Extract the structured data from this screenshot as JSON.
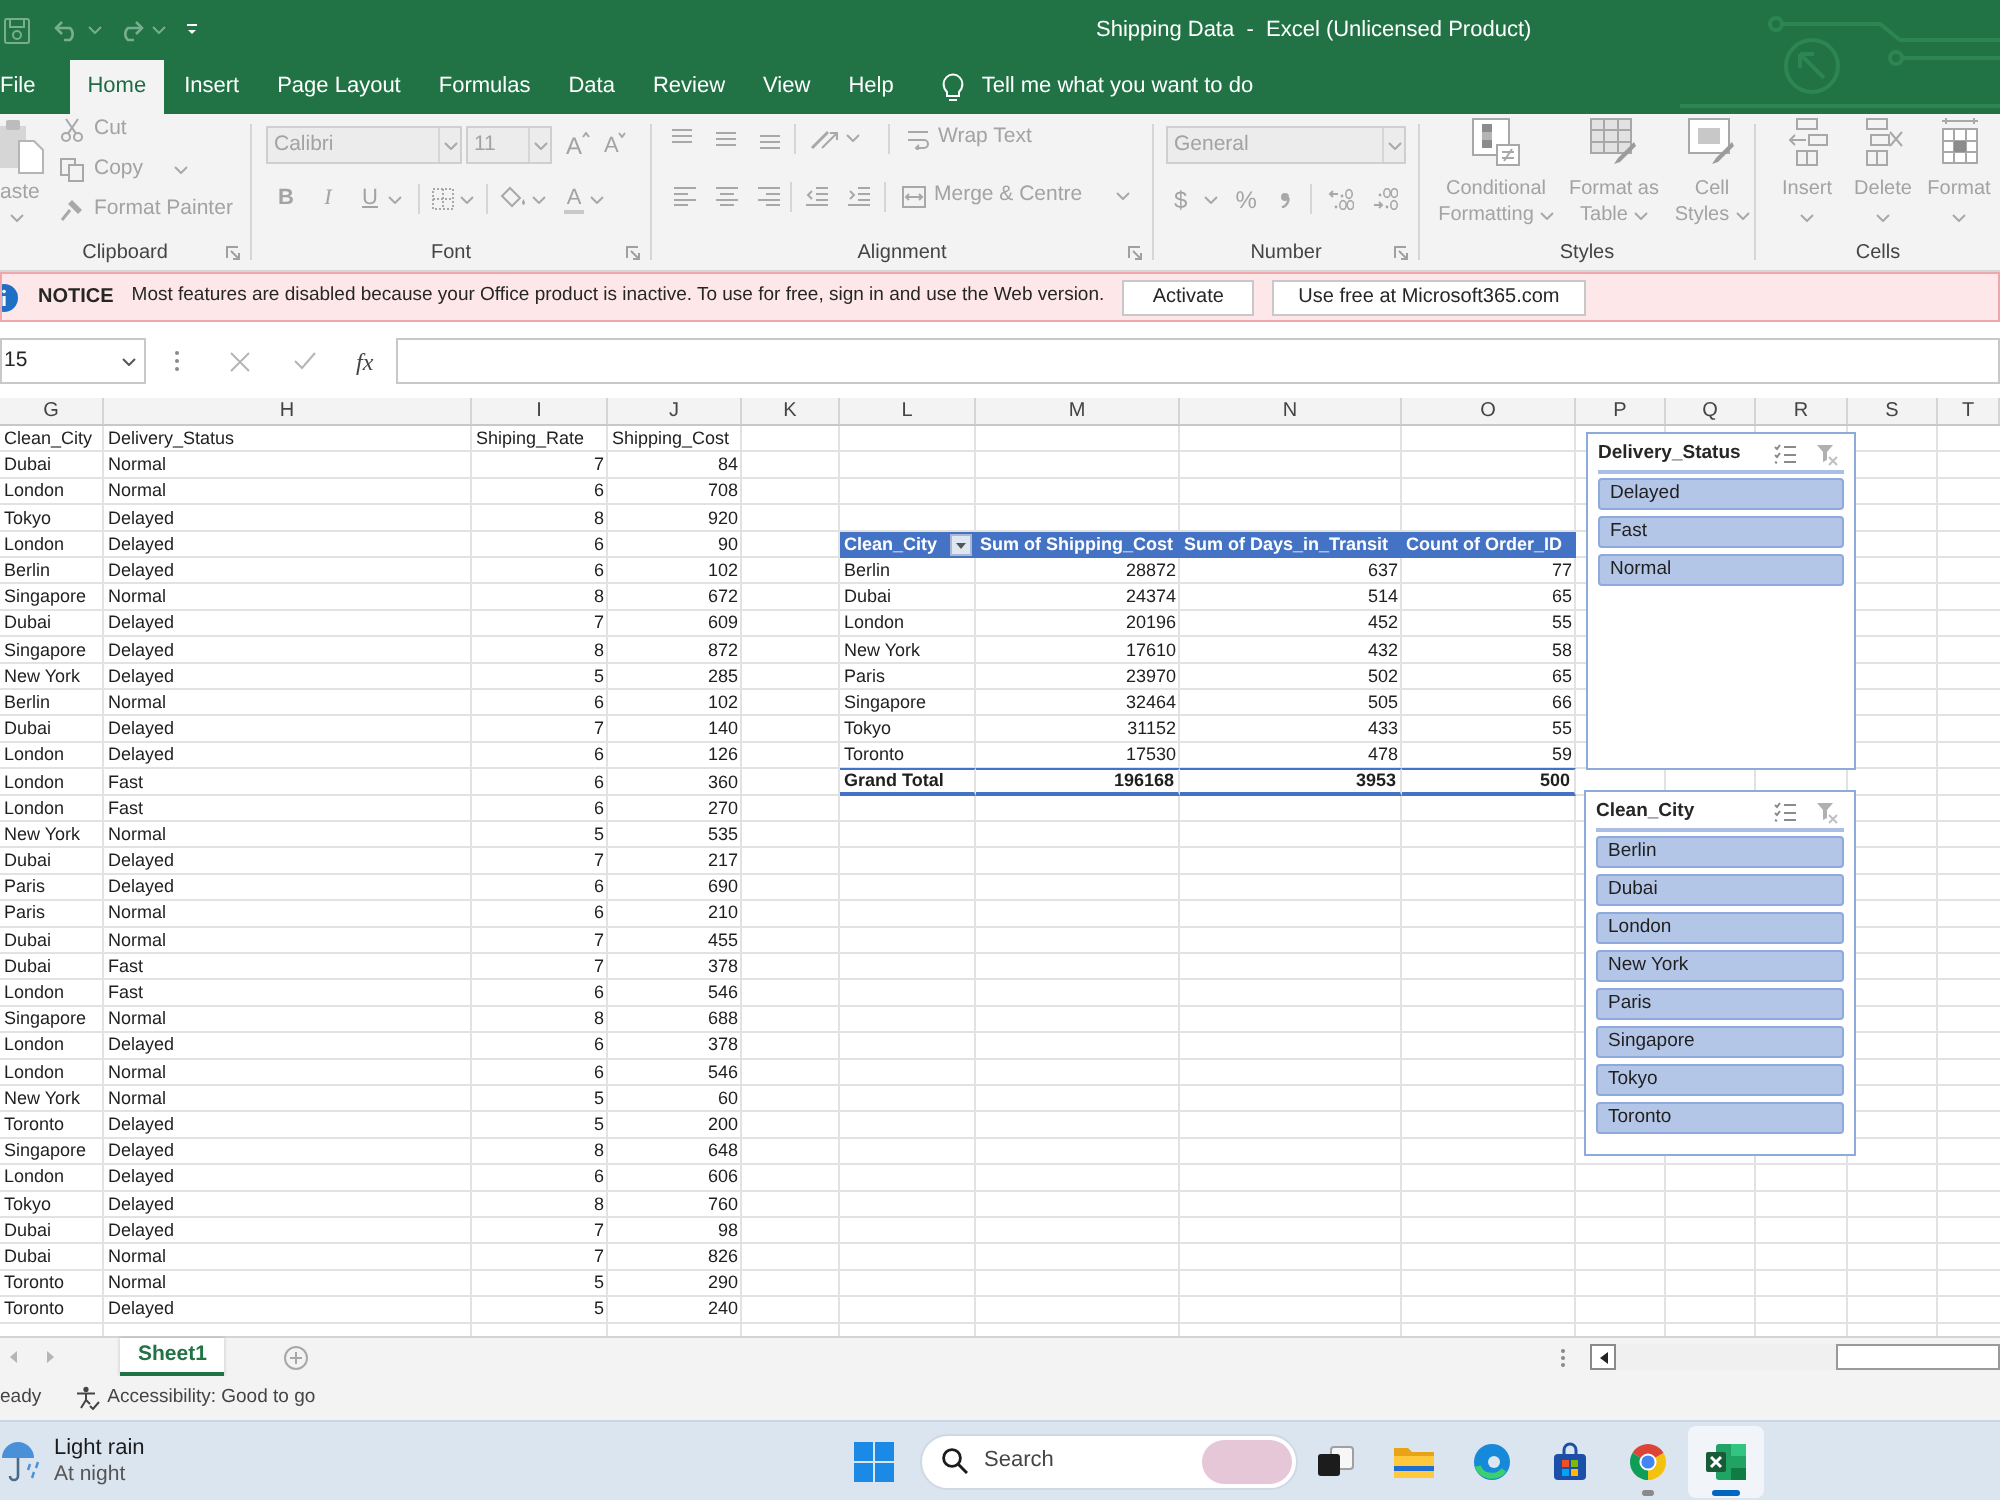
{
  "title_bar": {
    "title": "Shipping Data  -  Excel (Unlicensed Product)"
  },
  "ribbon_tabs": [
    {
      "label": "File",
      "selected": false
    },
    {
      "label": "Home",
      "selected": true
    },
    {
      "label": "Insert",
      "selected": false
    },
    {
      "label": "Page Layout",
      "selected": false
    },
    {
      "label": "Formulas",
      "selected": false
    },
    {
      "label": "Data",
      "selected": false
    },
    {
      "label": "Review",
      "selected": false
    },
    {
      "label": "View",
      "selected": false
    },
    {
      "label": "Help",
      "selected": false
    }
  ],
  "tell_me": "Tell me what you want to do",
  "ribbon": {
    "disabled": true,
    "clipboard": {
      "label": "Clipboard",
      "paste": "aste",
      "cut": "Cut",
      "copy": "Copy",
      "format_painter": "Format Painter"
    },
    "font": {
      "label": "Font",
      "font_name": "Calibri",
      "font_size": "11",
      "grow": "A",
      "shrink": "A",
      "bold": "B",
      "italic": "I",
      "underline": "U",
      "font_color": "A"
    },
    "alignment": {
      "label": "Alignment",
      "wrap_text": "Wrap Text",
      "merge": "Merge & Centre"
    },
    "number": {
      "label": "Number",
      "format": "General",
      "currency": "$",
      "percent": "%"
    },
    "styles": {
      "label": "Styles",
      "buttons": [
        {
          "kind": "conditional",
          "lines": [
            "Conditional",
            "Formatting"
          ]
        },
        {
          "kind": "table",
          "lines": [
            "Format as",
            "Table"
          ]
        },
        {
          "kind": "cell-styles",
          "lines": [
            "Cell",
            "Styles"
          ]
        }
      ]
    },
    "cells": {
      "label": "Cells",
      "buttons": [
        {
          "kind": "insert",
          "label": "Insert"
        },
        {
          "kind": "delete",
          "label": "Delete"
        },
        {
          "kind": "format",
          "label": "Format"
        }
      ]
    }
  },
  "notice": {
    "heading": "NOTICE",
    "message": "Most features are disabled because your Office product is inactive. To use for free, sign in and use the Web version.",
    "buttons": [
      "Activate",
      "Use free at Microsoft365.com"
    ]
  },
  "formula_bar": {
    "name_box": "15",
    "function_label": "fx"
  },
  "sheet": {
    "columns": [
      "G",
      "H",
      "I",
      "J",
      "K",
      "L",
      "M",
      "N",
      "O",
      "P",
      "Q",
      "R",
      "S",
      "T"
    ],
    "header": [
      "Clean_City",
      "Delivery_Status",
      "Shiping_Rate",
      "Shipping_Cost"
    ],
    "rows": [
      [
        "Dubai",
        "Normal",
        "7",
        "84"
      ],
      [
        "London",
        "Normal",
        "6",
        "708"
      ],
      [
        "Tokyo",
        "Delayed",
        "8",
        "920"
      ],
      [
        "London",
        "Delayed",
        "6",
        "90"
      ],
      [
        "Berlin",
        "Delayed",
        "6",
        "102"
      ],
      [
        "Singapore",
        "Normal",
        "8",
        "672"
      ],
      [
        "Dubai",
        "Delayed",
        "7",
        "609"
      ],
      [
        "Singapore",
        "Delayed",
        "8",
        "872"
      ],
      [
        "New York",
        "Delayed",
        "5",
        "285"
      ],
      [
        "Berlin",
        "Normal",
        "6",
        "102"
      ],
      [
        "Dubai",
        "Delayed",
        "7",
        "140"
      ],
      [
        "London",
        "Delayed",
        "6",
        "126"
      ],
      [
        "London",
        "Fast",
        "6",
        "360"
      ],
      [
        "London",
        "Fast",
        "6",
        "270"
      ],
      [
        "New York",
        "Normal",
        "5",
        "535"
      ],
      [
        "Dubai",
        "Delayed",
        "7",
        "217"
      ],
      [
        "Paris",
        "Delayed",
        "6",
        "690"
      ],
      [
        "Paris",
        "Normal",
        "6",
        "210"
      ],
      [
        "Dubai",
        "Normal",
        "7",
        "455"
      ],
      [
        "Dubai",
        "Fast",
        "7",
        "378"
      ],
      [
        "London",
        "Fast",
        "6",
        "546"
      ],
      [
        "Singapore",
        "Normal",
        "8",
        "688"
      ],
      [
        "London",
        "Delayed",
        "6",
        "378"
      ],
      [
        "London",
        "Normal",
        "6",
        "546"
      ],
      [
        "New York",
        "Normal",
        "5",
        "60"
      ],
      [
        "Toronto",
        "Delayed",
        "5",
        "200"
      ],
      [
        "Singapore",
        "Delayed",
        "8",
        "648"
      ],
      [
        "London",
        "Delayed",
        "6",
        "606"
      ],
      [
        "Tokyo",
        "Delayed",
        "8",
        "760"
      ],
      [
        "Dubai",
        "Delayed",
        "7",
        "98"
      ],
      [
        "Dubai",
        "Normal",
        "7",
        "826"
      ],
      [
        "Toronto",
        "Normal",
        "5",
        "290"
      ],
      [
        "Toronto",
        "Delayed",
        "5",
        "240"
      ]
    ]
  },
  "pivot": {
    "columns": [
      "Clean_City",
      "Sum of Shipping_Cost",
      "Sum of Days_in_Transit",
      "Count of Order_ID"
    ],
    "rows": [
      [
        "Berlin",
        "28872",
        "637",
        "77"
      ],
      [
        "Dubai",
        "24374",
        "514",
        "65"
      ],
      [
        "London",
        "20196",
        "452",
        "55"
      ],
      [
        "New York",
        "17610",
        "432",
        "58"
      ],
      [
        "Paris",
        "23970",
        "502",
        "65"
      ],
      [
        "Singapore",
        "32464",
        "505",
        "66"
      ],
      [
        "Tokyo",
        "31152",
        "433",
        "55"
      ],
      [
        "Toronto",
        "17530",
        "478",
        "59"
      ]
    ],
    "total": [
      "Grand Total",
      "196168",
      "3953",
      "500"
    ]
  },
  "slicers": [
    {
      "title": "Delivery_Status",
      "items": [
        {
          "label": "Delayed",
          "selected": true
        },
        {
          "label": "Fast",
          "selected": true
        },
        {
          "label": "Normal",
          "selected": true
        }
      ]
    },
    {
      "title": "Clean_City",
      "items": [
        {
          "label": "Berlin",
          "selected": true
        },
        {
          "label": "Dubai",
          "selected": true
        },
        {
          "label": "London",
          "selected": true
        },
        {
          "label": "New York",
          "selected": true
        },
        {
          "label": "Paris",
          "selected": true
        },
        {
          "label": "Singapore",
          "selected": true
        },
        {
          "label": "Tokyo",
          "selected": true
        },
        {
          "label": "Toronto",
          "selected": true
        }
      ]
    }
  ],
  "sheet_tabs": [
    {
      "label": "Sheet1",
      "selected": true
    }
  ],
  "status_bar": {
    "mode": "eady",
    "accessibility": "Accessibility: Good to go"
  },
  "taskbar": {
    "weather": {
      "condition": "Light rain",
      "time": "At night"
    },
    "search": {
      "placeholder": "Search"
    },
    "apps": [
      {
        "kind": "task-view",
        "running": false,
        "selected": false
      },
      {
        "kind": "folder",
        "running": false,
        "selected": false
      },
      {
        "kind": "wave-browser",
        "running": false,
        "selected": false
      },
      {
        "kind": "shop",
        "running": false,
        "selected": false
      },
      {
        "kind": "ball-browser",
        "running": true,
        "selected": false
      },
      {
        "kind": "sheet-app",
        "running": true,
        "selected": true
      }
    ]
  }
}
